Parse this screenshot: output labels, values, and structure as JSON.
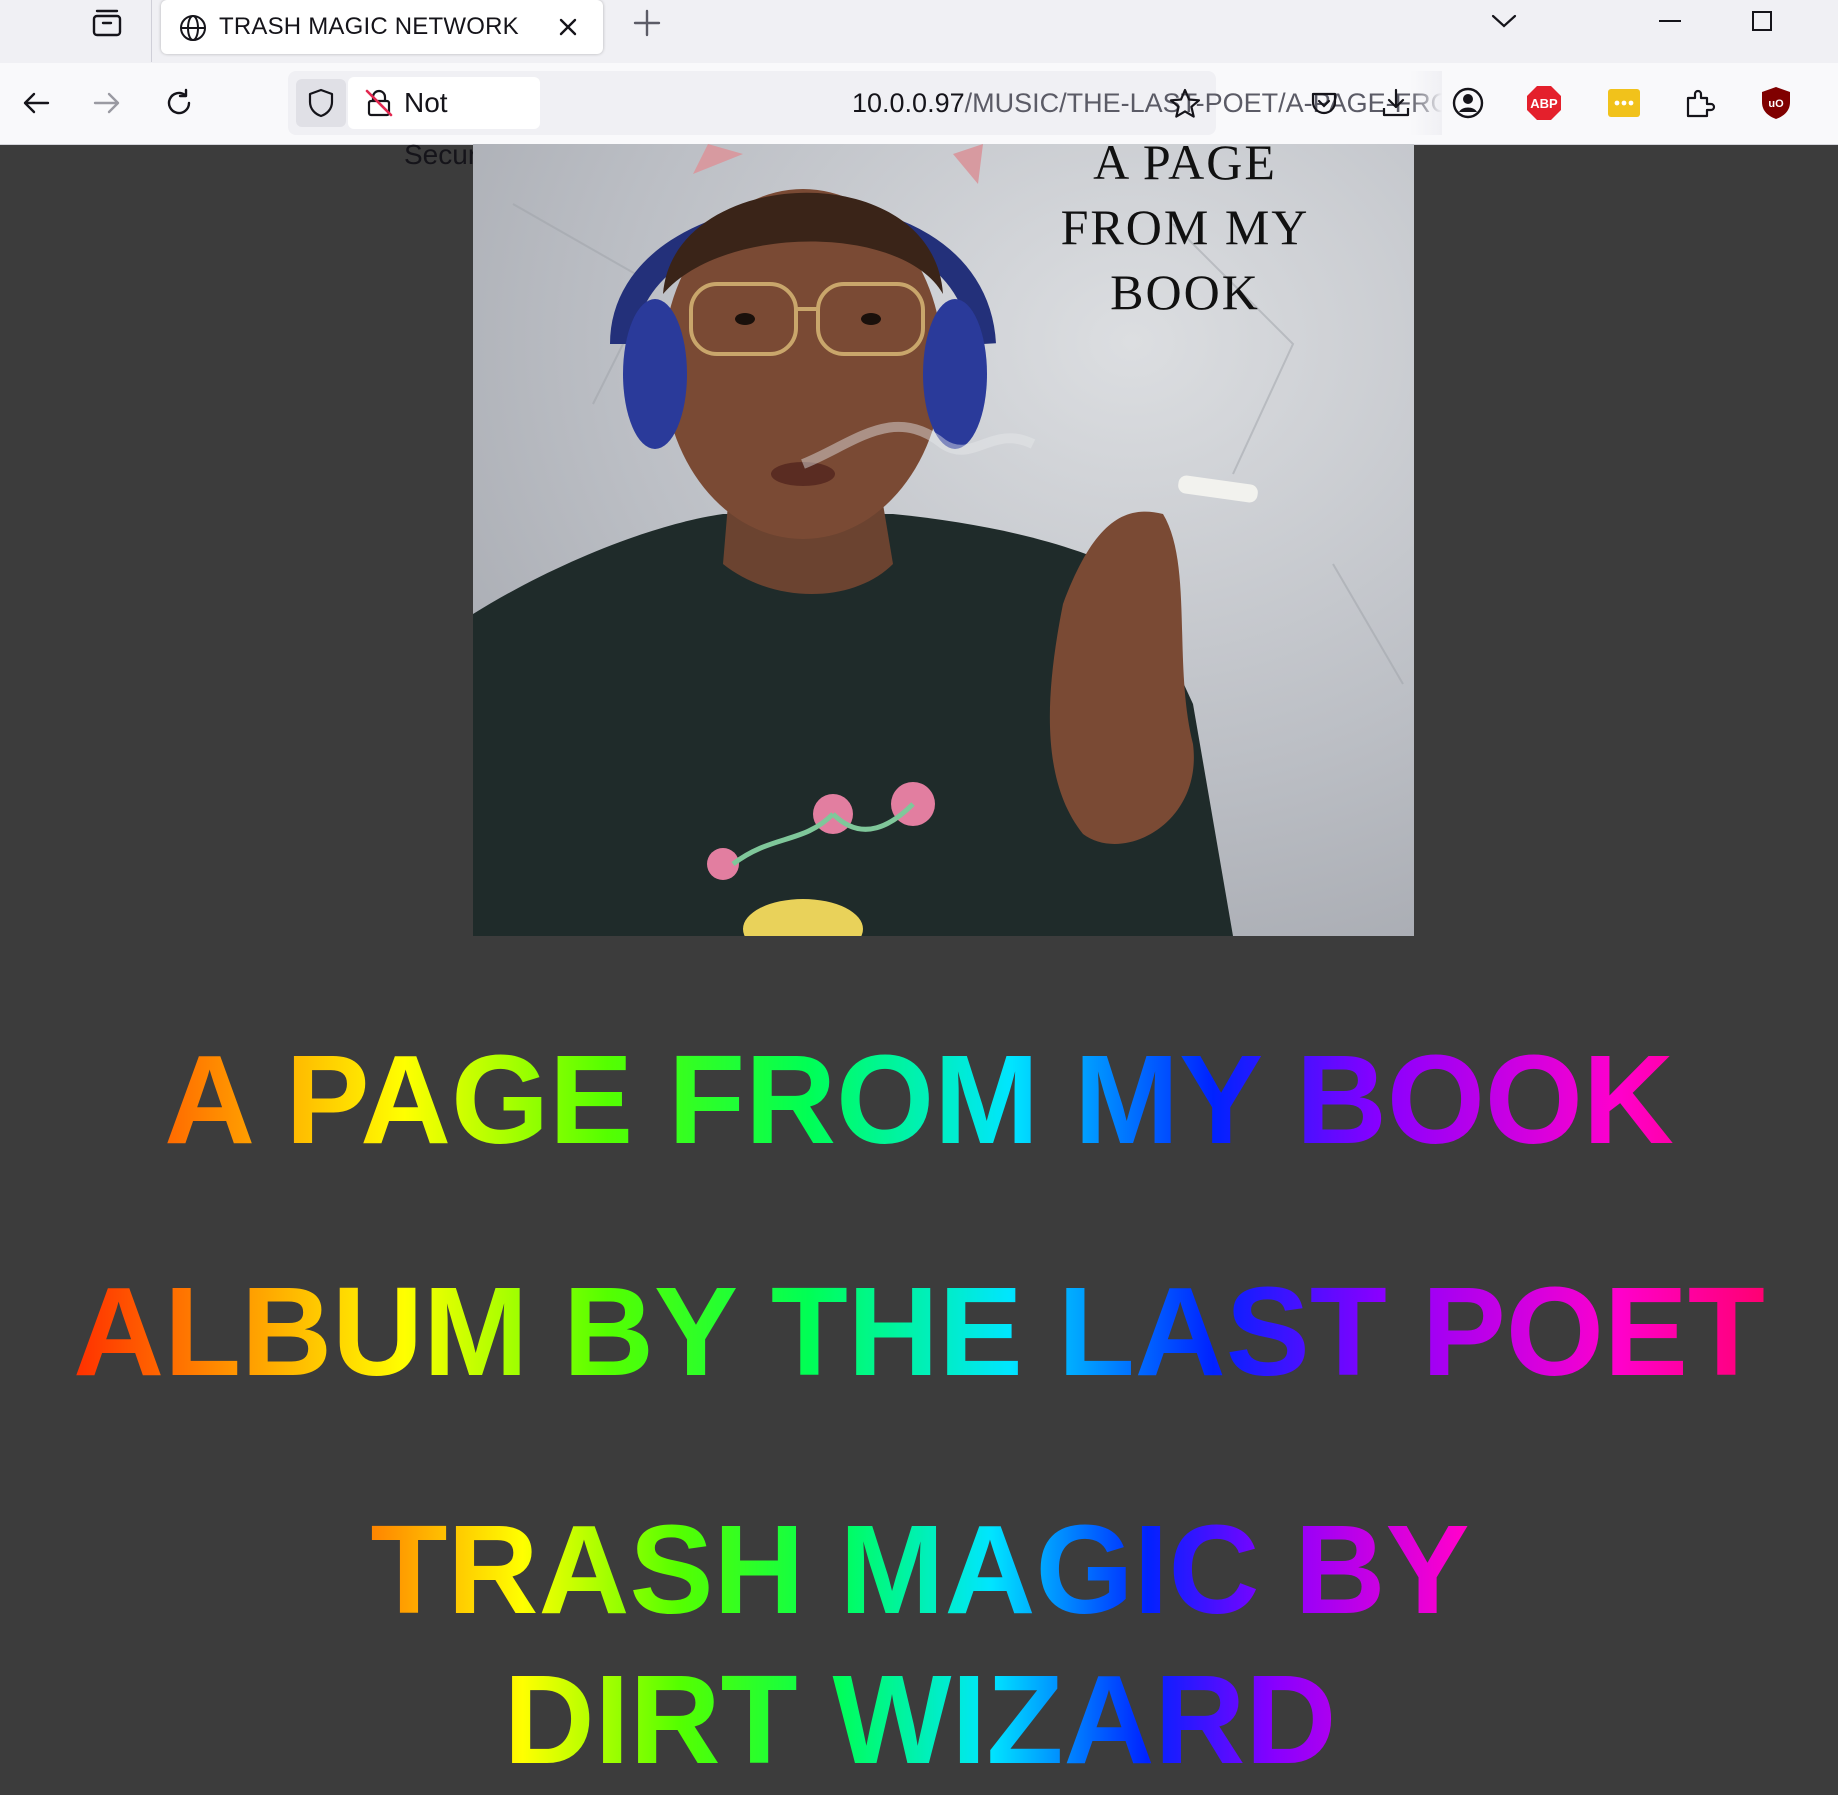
{
  "browser": {
    "tab_title": "TRASH MAGIC NETWORK",
    "security_label": "Not Secure",
    "url_host": "10.0.0.97",
    "url_path": "/MUSIC/THE-LAST-POET/A-PAGE-FROM",
    "icons": [
      "tab-list-icon",
      "globe-icon",
      "close-icon",
      "plus-icon",
      "chevron-down-icon",
      "minimize-icon",
      "maximize-icon",
      "back-arrow-icon",
      "forward-arrow-icon",
      "reload-icon",
      "shield-icon",
      "insecure-lock-icon",
      "bookmark-star-icon",
      "pocket-icon",
      "download-icon",
      "account-icon",
      "adblock-plus-icon",
      "password-manager-icon",
      "extensions-icon",
      "ublock-origin-icon"
    ],
    "extension_labels": {
      "abp": "ABP",
      "ublock": "uO"
    }
  },
  "page": {
    "cover_title_lines": [
      "A PAGE",
      "FROM MY",
      "BOOK"
    ],
    "headings": [
      "A PAGE FROM MY BOOK",
      "ALBUM BY THE LAST POET",
      "TRASH MAGIC BY DIRT WIZARD"
    ],
    "background": "#3c3c3c",
    "rainbow_colors": [
      "#ff0000",
      "#ff8c00",
      "#ffff00",
      "#55ff00",
      "#00ff55",
      "#00e5ff",
      "#0022ff",
      "#8800ff",
      "#ff00cc",
      "#ff0044"
    ]
  }
}
